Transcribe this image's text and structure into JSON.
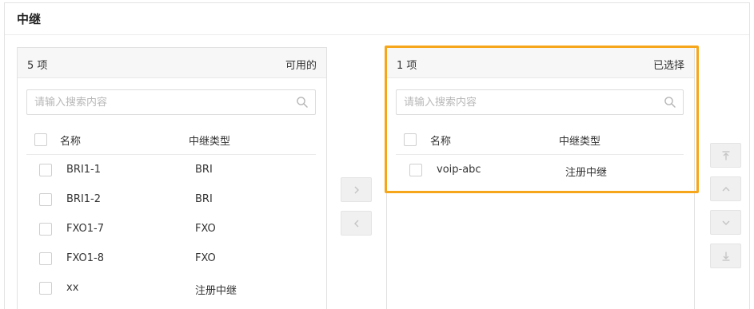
{
  "section": {
    "title": "中继"
  },
  "available": {
    "count_label": "5 项",
    "state_label": "可用的",
    "search_placeholder": "请输入搜索内容",
    "columns": {
      "name": "名称",
      "type": "中继类型"
    },
    "rows": [
      {
        "name": "BRI1-1",
        "type": "BRI"
      },
      {
        "name": "BRI1-2",
        "type": "BRI"
      },
      {
        "name": "FXO1-7",
        "type": "FXO"
      },
      {
        "name": "FXO1-8",
        "type": "FXO"
      },
      {
        "name": "xx",
        "type": "注册中继"
      }
    ]
  },
  "selected": {
    "count_label": "1 项",
    "state_label": "已选择",
    "search_placeholder": "请输入搜索内容",
    "columns": {
      "name": "名称",
      "type": "中继类型"
    },
    "rows": [
      {
        "name": "voip-abc",
        "type": "注册中继"
      }
    ]
  },
  "icons": {
    "search": "search-icon",
    "move_right": "chevron-right-icon",
    "move_left": "chevron-left-icon",
    "move_top": "move-to-top-icon",
    "move_up": "chevron-up-icon",
    "move_down": "chevron-down-icon",
    "move_bottom": "move-to-bottom-icon"
  },
  "colors": {
    "highlight": "#f5a61b",
    "button_bg": "#f0f0f0",
    "panel_header_bg": "#f7f7f7"
  }
}
